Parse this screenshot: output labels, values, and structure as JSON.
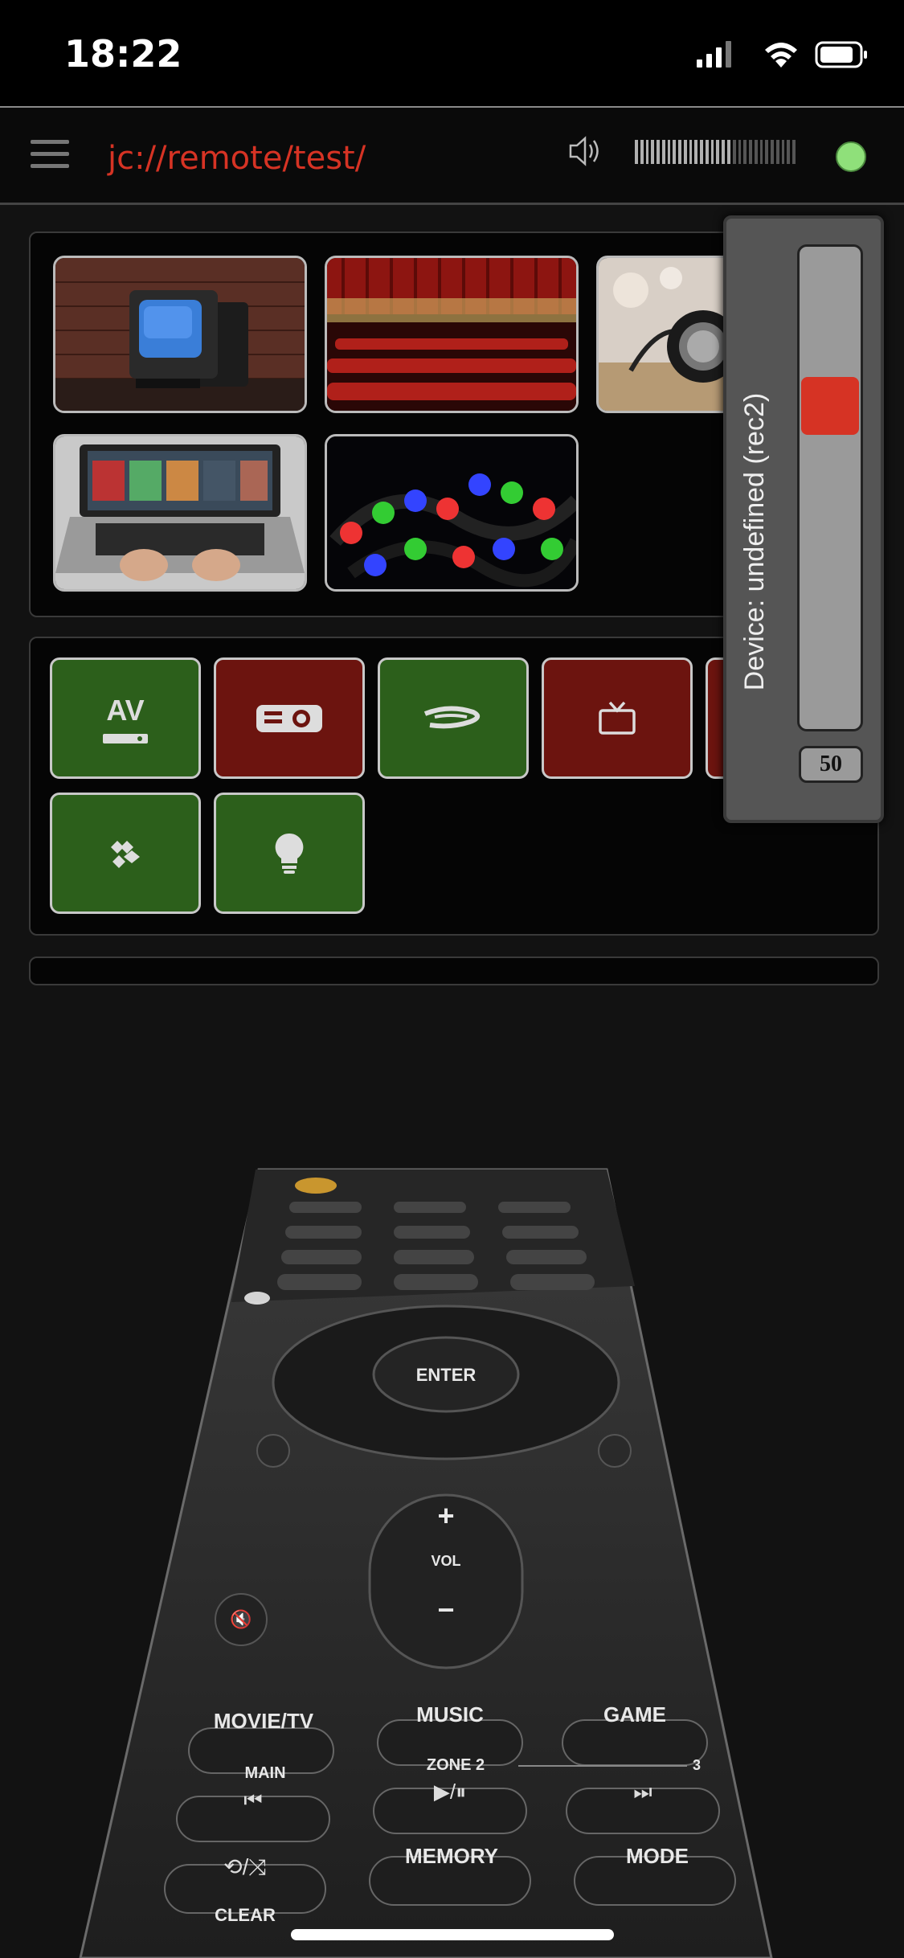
{
  "status": {
    "time": "18:22"
  },
  "app": {
    "title": "jc://remote/test/"
  },
  "colors": {
    "accent": "#d63324",
    "status_online": "#8fe07a",
    "tile_green": "#2c5f1b",
    "tile_red": "#6c140f"
  },
  "volume_meter": {
    "level": 0.6
  },
  "scenes": [
    {
      "name": "tv-scene",
      "icon": "retro-tv-photo"
    },
    {
      "name": "cinema-scene",
      "icon": "theater-seats-photo"
    },
    {
      "name": "music-scene",
      "icon": "headphones-photo"
    },
    {
      "name": "laptop-scene",
      "icon": "laptop-photo"
    },
    {
      "name": "led-scene",
      "icon": "led-strip-photo"
    }
  ],
  "devices": [
    {
      "label": "AV",
      "icon": "av-receiver-icon",
      "state": "on"
    },
    {
      "icon": "projector-icon",
      "state": "off"
    },
    {
      "icon": "bluray-icon",
      "state": "on"
    },
    {
      "icon": "tv-icon",
      "state": "off"
    },
    {
      "icon": "partially-hidden-device",
      "state": "off"
    },
    {
      "icon": "kodi-icon",
      "state": "on"
    },
    {
      "icon": "lightbulb-icon",
      "state": "on"
    }
  ],
  "volume_popup": {
    "label": "Device: undefined (rec2)",
    "value": "50",
    "level": 0.5
  },
  "remote": {
    "enter": "ENTER",
    "vol": "VOL",
    "movie_tv": "MOVIE/TV",
    "music": "MUSIC",
    "game": "GAME",
    "main": "MAIN",
    "zone2": "ZONE 2",
    "zone3": "3",
    "memory": "MEMORY",
    "mode": "MODE",
    "clear": "CLEAR"
  }
}
